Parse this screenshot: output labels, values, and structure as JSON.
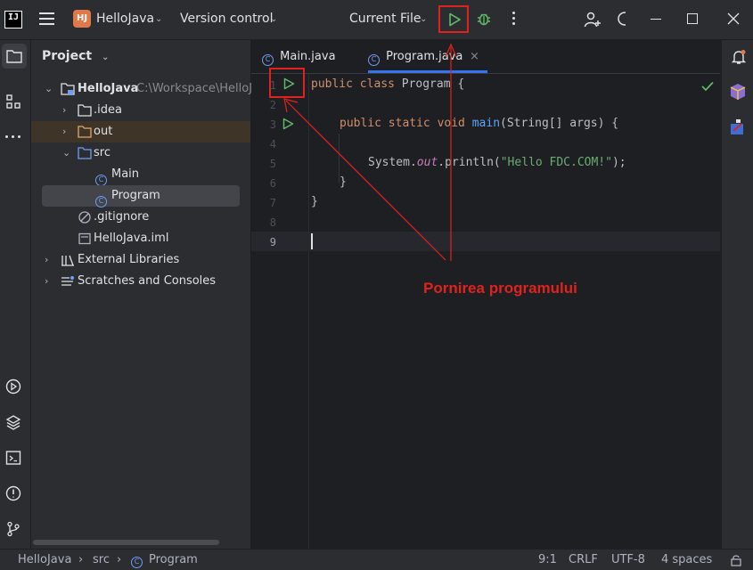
{
  "titlebar": {
    "logo": "IJ",
    "project_badge": "HJ",
    "project_name": "HelloJava",
    "version_control": "Version control",
    "run_config": "Current File",
    "icons": [
      "menu-icon",
      "run-icon",
      "debug-icon",
      "more-vert-icon",
      "add-user-icon",
      "refresh-icon",
      "minimize-icon",
      "maximize-icon",
      "close-icon"
    ]
  },
  "project_panel": {
    "title": "Project",
    "tree": [
      {
        "label": "HelloJava",
        "path": "C:\\Workspace\\HelloJ",
        "icon": "module-folder-icon"
      },
      {
        "label": ".idea",
        "icon": "folder-icon"
      },
      {
        "label": "out",
        "icon": "folder-icon"
      },
      {
        "label": "src",
        "icon": "source-folder-icon"
      },
      {
        "label": "Main",
        "icon": "class-icon"
      },
      {
        "label": "Program",
        "icon": "class-icon"
      },
      {
        "label": ".gitignore",
        "icon": "ignore-file-icon"
      },
      {
        "label": "HelloJava.iml",
        "icon": "iml-file-icon"
      },
      {
        "label": "External Libraries",
        "icon": "libraries-icon"
      },
      {
        "label": "Scratches and Consoles",
        "icon": "scratches-icon"
      }
    ]
  },
  "editor": {
    "tabs": [
      {
        "label": "Main.java",
        "active": false
      },
      {
        "label": "Program.java",
        "active": true
      }
    ],
    "line_numbers": [
      "1",
      "2",
      "3",
      "4",
      "5",
      "6",
      "7",
      "8",
      "9"
    ],
    "code": {
      "l1_kw": "public class",
      "l1_rest": " Program {",
      "l3_kw": "public static void",
      "l3_fn": "main",
      "l3_rest": "(String[] args) {",
      "l5_a": "System.",
      "l5_out": "out",
      "l5_b": ".println(",
      "l5_str": "\"Hello FDC.COM!\"",
      "l5_c": ");",
      "l6": "}",
      "l7": "}"
    }
  },
  "annotation": {
    "text": "Pornirea programului",
    "color": "#e0221f"
  },
  "statusbar": {
    "crumbs": [
      "HelloJava",
      "src",
      "Program"
    ],
    "position": "9:1",
    "line_sep": "CRLF",
    "encoding": "UTF-8",
    "indent": "4 spaces"
  },
  "colors": {
    "bg": "#1e1f22",
    "panel": "#2b2d30",
    "keyword": "#cf8e6d",
    "function": "#56a8f5",
    "string": "#6aab73",
    "run_green": "#5fb865",
    "accent_blue": "#3574f0"
  }
}
